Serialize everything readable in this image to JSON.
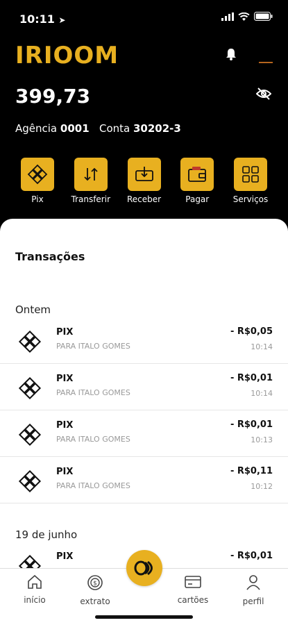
{
  "status": {
    "time": "10:11"
  },
  "brand": {
    "logo": "IRIOOM"
  },
  "account": {
    "balance": "399,73",
    "agencia_label": "Agência",
    "agencia": "0001",
    "conta_label": "Conta",
    "conta": "30202-3"
  },
  "actions": [
    {
      "label": "Pix",
      "icon": "pix-icon"
    },
    {
      "label": "Transferir",
      "icon": "transfer-icon"
    },
    {
      "label": "Receber",
      "icon": "receive-icon"
    },
    {
      "label": "Pagar",
      "icon": "wallet-icon"
    },
    {
      "label": "Serviços",
      "icon": "grid-icon"
    }
  ],
  "transactions": {
    "title": "Transações",
    "groups": [
      {
        "label": "Ontem",
        "items": [
          {
            "type": "PIX",
            "desc": "PARA ITALO GOMES",
            "amount": "- R$0,05",
            "time": "10:14"
          },
          {
            "type": "PIX",
            "desc": "PARA ITALO GOMES",
            "amount": "- R$0,01",
            "time": "10:14"
          },
          {
            "type": "PIX",
            "desc": "PARA ITALO GOMES",
            "amount": "- R$0,01",
            "time": "10:13"
          },
          {
            "type": "PIX",
            "desc": "PARA ITALO GOMES",
            "amount": "- R$0,11",
            "time": "10:12"
          }
        ]
      },
      {
        "label": "19 de junho",
        "items": [
          {
            "type": "PIX",
            "desc": "",
            "amount": "- R$0,01",
            "time": ""
          }
        ]
      }
    ]
  },
  "tabbar": {
    "items": [
      {
        "label": "início",
        "icon": "home-icon"
      },
      {
        "label": "extrato",
        "icon": "statement-icon"
      },
      {
        "label": "cartões",
        "icon": "card-icon"
      },
      {
        "label": "perfil",
        "icon": "profile-icon"
      }
    ]
  },
  "colors": {
    "accent": "#E8B020",
    "background": "#000000"
  }
}
